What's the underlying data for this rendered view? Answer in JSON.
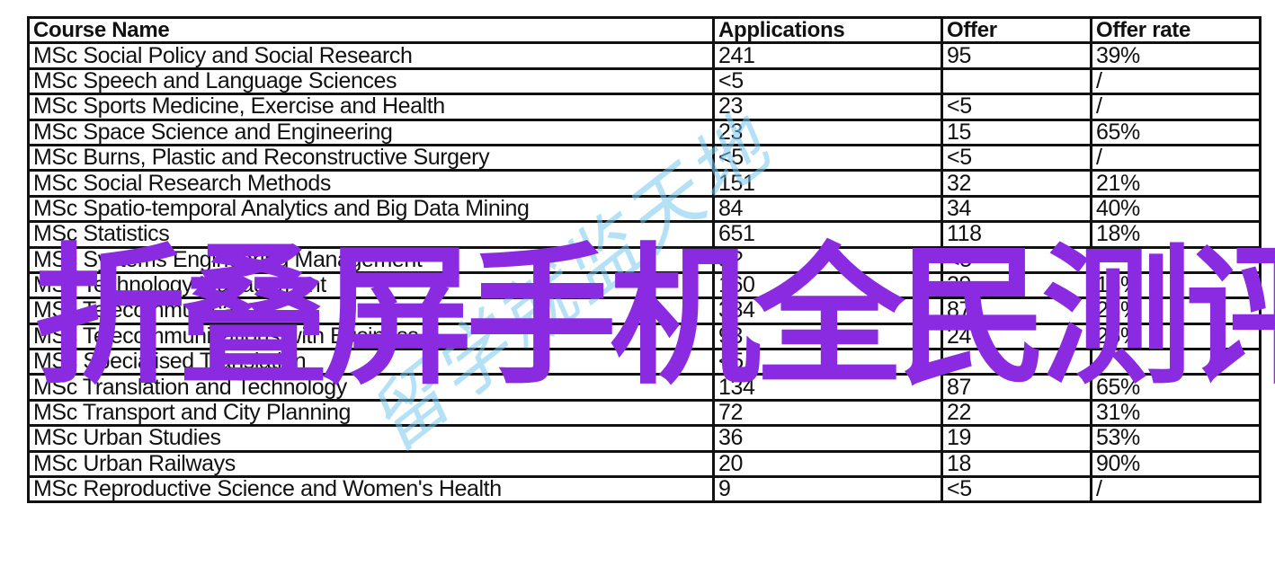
{
  "table": {
    "headers": [
      "Course Name",
      "Applications",
      "Offer",
      "Offer rate"
    ],
    "rows": [
      [
        "MSc Social Policy and Social Research",
        "241",
        "95",
        "39%"
      ],
      [
        "MSc Speech and Language Sciences",
        "<5",
        "",
        "/"
      ],
      [
        "MSc Sports Medicine, Exercise and Health",
        "23",
        "<5",
        "/"
      ],
      [
        "MSc Space Science and Engineering",
        "23",
        "15",
        "65%"
      ],
      [
        "MSc Burns, Plastic and Reconstructive Surgery",
        "<5",
        "<5",
        "/"
      ],
      [
        "MSc Social Research Methods",
        "151",
        "32",
        "21%"
      ],
      [
        "MSc Spatio-temporal Analytics and Big Data Mining",
        "84",
        "34",
        "40%"
      ],
      [
        "MSc Statistics",
        "651",
        "118",
        "18%"
      ],
      [
        "MSc Systems Engineering Management",
        "3?",
        "<5",
        "/"
      ],
      [
        "MSc Technology Management",
        "160",
        "29",
        "18%"
      ],
      [
        "MSc Telecommunications",
        "384",
        "87",
        "23%"
      ],
      [
        "MSc Telecommunications with Business",
        "93",
        "24",
        "26%"
      ],
      [
        "MSc Specialised Translation",
        "<5",
        "",
        "/"
      ],
      [
        "MSc Translation and Technology",
        "134",
        "87",
        "65%"
      ],
      [
        "MSc Transport and City Planning",
        "72",
        "22",
        "31%"
      ],
      [
        "MSc Urban Studies",
        "36",
        "19",
        "53%"
      ],
      [
        "MSc Urban Railways",
        "20",
        "18",
        "90%"
      ],
      [
        "MSc Reproductive Science and Women's Health",
        "9",
        "<5",
        "/"
      ]
    ]
  },
  "overlay_text": "折叠屏手机全民测评，",
  "watermark_text": "留学就监天地",
  "colors": {
    "overlay": "#8a2be2",
    "watermark": "#78c8f0",
    "border": "#111111"
  }
}
